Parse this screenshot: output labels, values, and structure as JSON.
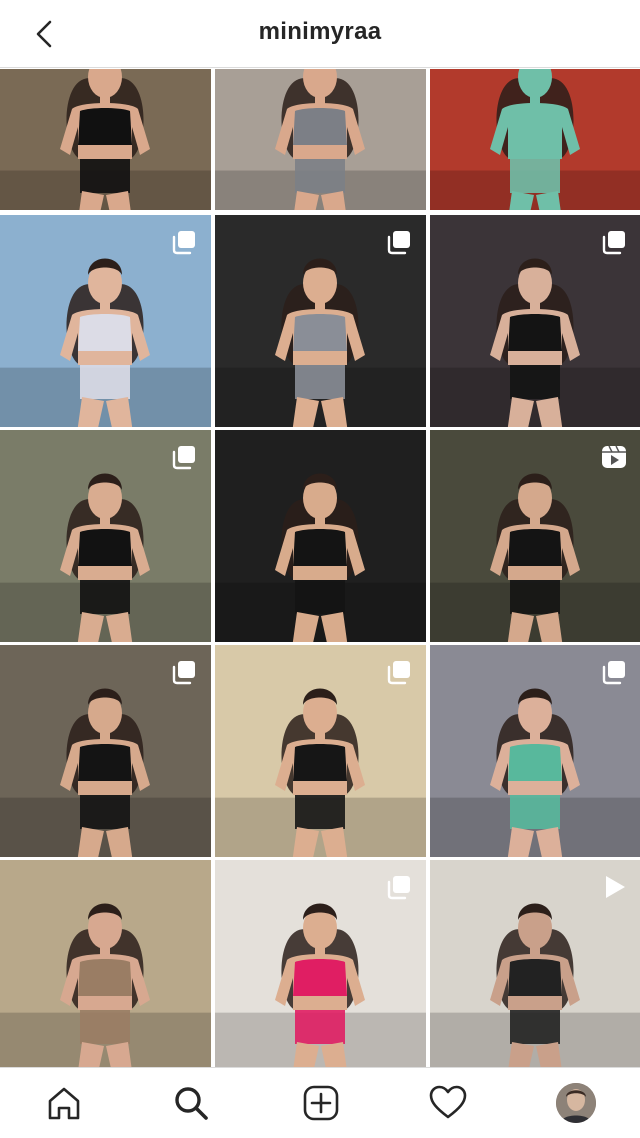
{
  "header": {
    "username": "minimyraa"
  },
  "tiles": [
    {
      "bg": "#7a6a55",
      "fig": "#d9a88c",
      "top": "#111111",
      "badge": "none"
    },
    {
      "bg": "#a89f96",
      "fig": "#d9a88c",
      "top": "#7c7f86",
      "badge": "none"
    },
    {
      "bg": "#b23a2c",
      "fig": "#6fbfa8",
      "top": "#6fbfa8",
      "badge": "none"
    },
    {
      "bg": "#8cb0cf",
      "fig": "#e0b59c",
      "top": "#dcdce6",
      "badge": "carousel"
    },
    {
      "bg": "#2a2a2a",
      "fig": "#dcae90",
      "top": "#8a8e97",
      "badge": "carousel"
    },
    {
      "bg": "#3b3438",
      "fig": "#d8b09a",
      "top": "#141414",
      "badge": "carousel"
    },
    {
      "bg": "#7a7c68",
      "fig": "#d9ac90",
      "top": "#121212",
      "badge": "carousel"
    },
    {
      "bg": "#1f1f1f",
      "fig": "#d8ab8c",
      "top": "#141414",
      "badge": "none"
    },
    {
      "bg": "#4a4a3c",
      "fig": "#d4a88c",
      "top": "#141414",
      "badge": "reel"
    },
    {
      "bg": "#6d6558",
      "fig": "#d6a98c",
      "top": "#141414",
      "badge": "carousel"
    },
    {
      "bg": "#d8c9a8",
      "fig": "#dcae90",
      "top": "#161616",
      "badge": "carousel"
    },
    {
      "bg": "#8a8a94",
      "fig": "#dcb09a",
      "top": "#58b89c",
      "badge": "carousel"
    },
    {
      "bg": "#b8a88a",
      "fig": "#d7a890",
      "top": "#9a7d64",
      "badge": "none"
    },
    {
      "bg": "#e4e0da",
      "fig": "#dcae90",
      "top": "#e01e63",
      "badge": "carousel"
    },
    {
      "bg": "#d8d4cc",
      "fig": "#c9a08a",
      "top": "#222222",
      "badge": "video"
    }
  ],
  "nav": {
    "items": [
      "home-icon",
      "search-icon",
      "new-post-icon",
      "activity-icon",
      "profile-avatar"
    ]
  }
}
